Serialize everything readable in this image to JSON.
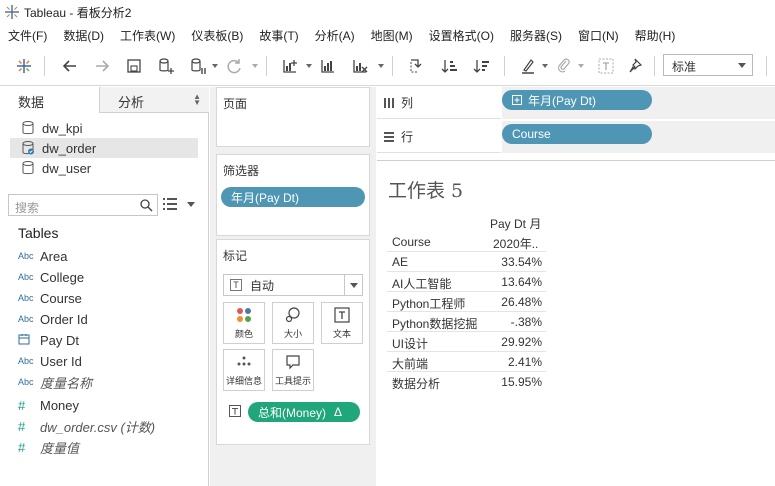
{
  "window": {
    "title": "Tableau - 看板分析2"
  },
  "menu": [
    "文件(F)",
    "数据(D)",
    "工作表(W)",
    "仪表板(B)",
    "故事(T)",
    "分析(A)",
    "地图(M)",
    "设置格式(O)",
    "服务器(S)",
    "窗口(N)",
    "帮助(H)"
  ],
  "toolbar": {
    "fit_select": "标准"
  },
  "left_pane": {
    "tabs": {
      "data": "数据",
      "analysis": "分析"
    },
    "datasources": [
      {
        "name": "dw_kpi"
      },
      {
        "name": "dw_order"
      },
      {
        "name": "dw_user"
      }
    ],
    "search_placeholder": "搜索",
    "tables_header": "Tables",
    "dimensions": [
      {
        "type": "Abc",
        "name": "Area"
      },
      {
        "type": "Abc",
        "name": "College"
      },
      {
        "type": "Abc",
        "name": "Course"
      },
      {
        "type": "Abc",
        "name": "Order Id"
      },
      {
        "type": "date",
        "name": "Pay Dt"
      },
      {
        "type": "Abc",
        "name": "User Id"
      },
      {
        "type": "Abc",
        "name": "度量名称"
      }
    ],
    "measures": [
      {
        "type": "#",
        "name": "Money"
      },
      {
        "type": "#",
        "name": "dw_order.csv (计数)"
      },
      {
        "type": "#",
        "name": "度量值"
      }
    ]
  },
  "cards": {
    "pages": "页面",
    "filters": "筛选器",
    "filter_pill": "年月(Pay Dt)",
    "marks": "标记",
    "mark_type": "自动",
    "mark_type_icon": "T",
    "mark_buttons": {
      "color": "颜色",
      "size": "大小",
      "text": "文本",
      "detail": "详细信息",
      "tooltip": "工具提示"
    },
    "text_pill": "总和(Money)",
    "text_pill_delta": "Δ",
    "text_pill_icon": "T"
  },
  "shelves": {
    "columns_label": "列",
    "columns_pill": "年月(Pay Dt)",
    "rows_label": "行",
    "rows_pill": "Course"
  },
  "sheet": {
    "title": "工作表 5",
    "col_header_top": "Pay Dt 月",
    "col_header_bottom": "2020年..",
    "row_header": "Course",
    "rows": [
      {
        "course": "AE",
        "value": "33.54%"
      },
      {
        "course": "AI人工智能",
        "value": "13.64%"
      },
      {
        "course": "Python工程师",
        "value": "26.48%"
      },
      {
        "course": "Python数据挖掘",
        "value": "-.38%"
      },
      {
        "course": "UI设计",
        "value": "29.92%"
      },
      {
        "course": "大前端",
        "value": "2.41%"
      },
      {
        "course": "数据分析",
        "value": "15.95%"
      }
    ]
  }
}
